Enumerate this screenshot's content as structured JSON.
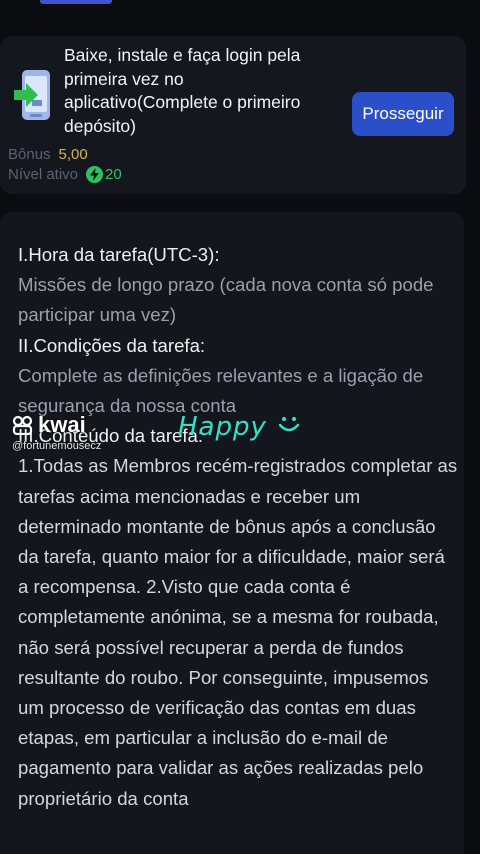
{
  "task": {
    "description": "Baixe, instale e faça login pela primeira vez no aplicativo(Complete o primeiro depósito)",
    "proceed_label": "Prosseguir",
    "bonus_label": "Bônus",
    "bonus_value": "5,00",
    "level_label": "Nível ativo",
    "level_value": "20",
    "icons": {
      "app": "phone-download-icon",
      "level": "lightning-icon"
    },
    "colors": {
      "button": "#2b4ec9",
      "bonus": "#d6b44a",
      "level": "#2ec35c"
    }
  },
  "info": {
    "heading1": "I.Hora da tarefa(UTC-3):",
    "text1": "Missões de longo prazo (cada nova conta só pode participar uma vez)",
    "heading2": "II.Condições da tarefa:",
    "text2": "Complete as definições relevantes e a ligação de segurança da nossa conta",
    "heading3": "III.Conteúdo da tarefa:",
    "text3": "1.Todas as Membros recém-registrados completar as tarefas acima mencionadas e receber um determinado montante de bônus após a conclusão da tarefa, quanto maior for a dificuldade, maior será a recompensa. 2.Visto que cada conta é completamente anónima, se a mesma for roubada, não será possível recuperar a perda de fundos resultante do roubo. Por conseguinte, impusemos um processo de verificação das contas em duas etapas, em particular a inclusão do e-mail de pagamento para validar as ações realizadas pelo proprietário da conta"
  },
  "overlay": {
    "logo_text": "kwai",
    "handle": "@fortunemousecz",
    "sticker": "Happy"
  }
}
